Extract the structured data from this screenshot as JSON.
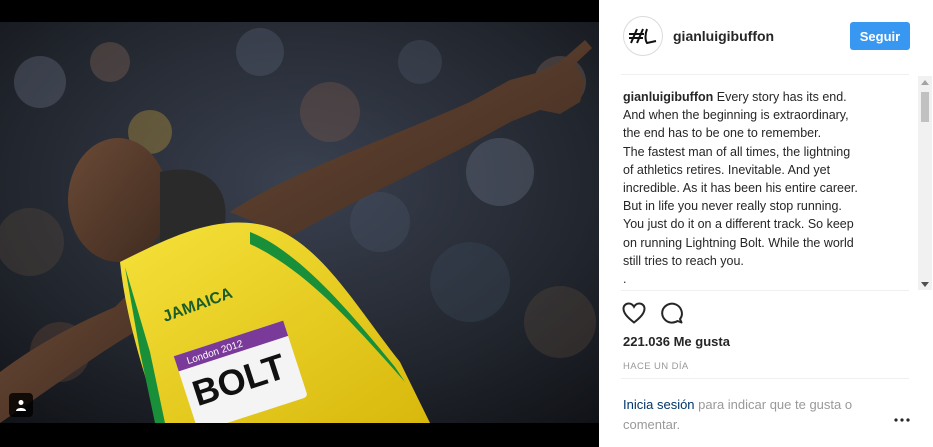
{
  "post": {
    "username": "gianluigibuffon",
    "follow_label": "Seguir",
    "avatar_icon": "signature-logo-icon",
    "caption_user": "gianluigibuffon",
    "caption_text": " Every story has its end.\nAnd when the beginning is extraordinary,\nthe end has to be one to remember.\nThe fastest man of all times, the lightning\nof athletics retires. Inevitable. And yet\nincredible. As it has been his entire career.\nBut in life you never really stop running.\nYou just do it on a different track. So keep\non running Lightning Bolt. While the world\nstill tries to reach you.\n.",
    "likes": "221.036 Me gusta",
    "timestamp": "HACE UN DÍA",
    "login_link": "Inicia sesión",
    "login_rest": " para indicar que te gusta o comentar.",
    "icons": {
      "like": "heart-icon",
      "comment": "comment-icon",
      "more": "more-options-icon",
      "tag": "user-tag-icon"
    }
  },
  "photo": {
    "bib_top": "London 2012",
    "bib_name": "BOLT",
    "jersey_text": "JAMAICA"
  },
  "colors": {
    "follow_button": "#3897f0",
    "link": "#003569",
    "muted": "#999999",
    "text": "#262626",
    "jersey_yellow": "#f2d716",
    "jersey_green": "#1a8f3a"
  }
}
